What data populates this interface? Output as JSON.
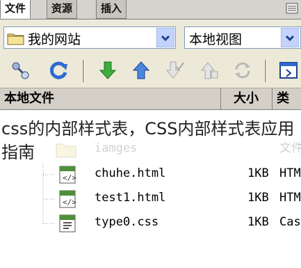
{
  "tabs": [
    {
      "label": "文件",
      "active": true
    },
    {
      "label": "资源",
      "active": false
    },
    {
      "label": "插入",
      "active": false
    }
  ],
  "site_dropdown": {
    "value": "我的网站",
    "icon": "folder-icon"
  },
  "view_dropdown": {
    "value": "本地视图"
  },
  "toolbar": {
    "buttons": [
      {
        "icon": "connect-icon"
      },
      {
        "icon": "refresh-icon"
      },
      {
        "icon": "get-down-arrow-icon"
      },
      {
        "icon": "put-up-arrow-icon"
      },
      {
        "icon": "check-out-icon"
      },
      {
        "icon": "check-in-icon"
      },
      {
        "icon": "synchronize-icon"
      },
      {
        "icon": "expand-icon"
      }
    ],
    "colors": {
      "green": "#2e9a2e",
      "blue": "#2f6ad0",
      "gray": "#b0b0b0"
    }
  },
  "header": {
    "name": "本地文件",
    "size": "大小",
    "type": "类型"
  },
  "files": [
    {
      "name": "iamges",
      "size": "",
      "type": "文件",
      "icon": "folder-icon",
      "faded": true
    },
    {
      "name": "chuhe.html",
      "size": "1KB",
      "type": "HTM",
      "icon": "html-file-icon",
      "faded": false
    },
    {
      "name": "test1.html",
      "size": "1KB",
      "type": "HTM",
      "icon": "html-file-icon",
      "faded": false
    },
    {
      "name": "type0.css",
      "size": "1KB",
      "type": "Cas",
      "icon": "css-file-icon",
      "faded": false
    }
  ],
  "caption": "css的内部样式表，CSS内部样式表应用指南"
}
